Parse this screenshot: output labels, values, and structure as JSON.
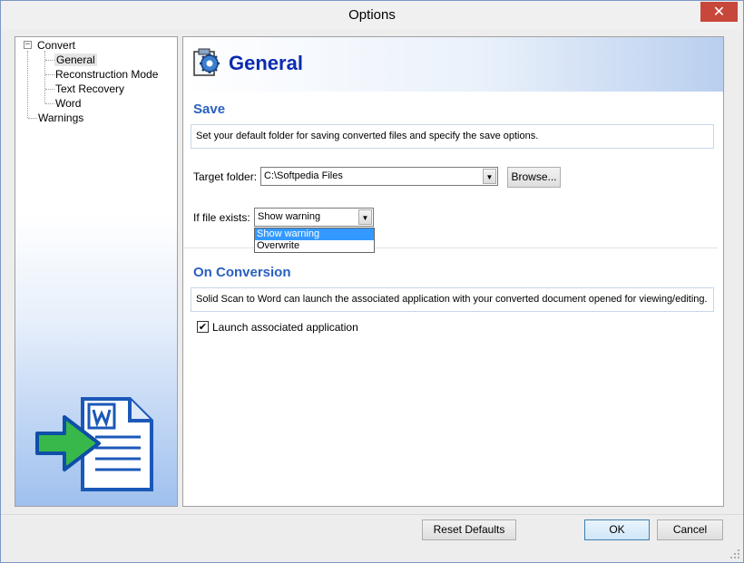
{
  "window": {
    "title": "Options",
    "close_glyph": "✕"
  },
  "tree": {
    "root": "Convert",
    "expander_glyph": "−",
    "children": [
      "General",
      "Reconstruction Mode",
      "Text Recovery",
      "Word"
    ],
    "sibling": "Warnings"
  },
  "header": {
    "title": "General",
    "icon": "settings-page-icon"
  },
  "save": {
    "title": "Save",
    "description": "Set your default folder for saving converted files and specify the save options.",
    "target_label": "Target folder:",
    "target_value": "C:\\Softpedia Files",
    "browse_label": "Browse...",
    "exists_label": "If file exists:",
    "exists_value": "Show warning",
    "exists_options": [
      "Show warning",
      "Overwrite"
    ],
    "dropdown_arrow": "▼"
  },
  "conversion": {
    "title": "On Conversion",
    "description": "Solid Scan to Word can launch the associated application with your converted document opened for viewing/editing.",
    "launch_label": "Launch associated application",
    "launch_checked": true,
    "check_glyph": "✔"
  },
  "footer": {
    "reset_label": "Reset Defaults",
    "ok_label": "OK",
    "cancel_label": "Cancel"
  },
  "colors": {
    "accent": "#0a2bb0",
    "section": "#2a5fc0",
    "highlight": "#3399ff",
    "close": "#c7473b"
  }
}
